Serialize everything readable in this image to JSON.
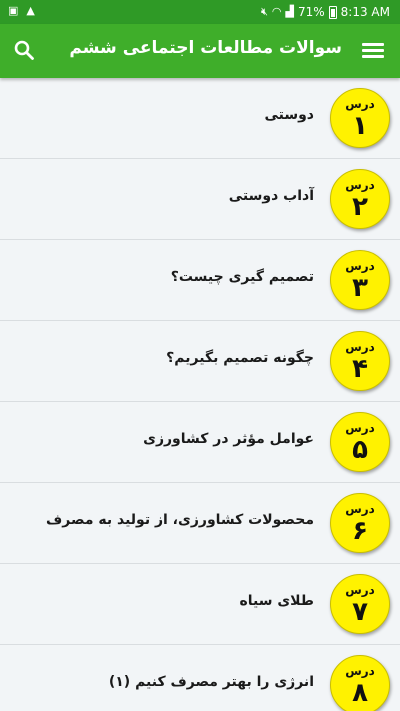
{
  "status_bar": {
    "battery": "71%",
    "time": "8:13 AM"
  },
  "app_bar": {
    "title": "سوالات مطالعات اجتماعی ششم",
    "menu_icon": "hamburger-menu-icon",
    "search_icon": "search-icon"
  },
  "colors": {
    "status_bar": "#2f9a26",
    "app_bar": "#3fae2a",
    "badge": "#fff200",
    "background": "#f2f5f7"
  },
  "lessons": [
    {
      "badge_label": "درس",
      "number": "۱",
      "title": "دوستی"
    },
    {
      "badge_label": "درس",
      "number": "۲",
      "title": "آداب دوستی"
    },
    {
      "badge_label": "درس",
      "number": "۳",
      "title": "تصمیم گیری چیست؟"
    },
    {
      "badge_label": "درس",
      "number": "۴",
      "title": "چگونه تصمیم بگیریم؟"
    },
    {
      "badge_label": "درس",
      "number": "۵",
      "title": "عوامل مؤثر در کشاورزی"
    },
    {
      "badge_label": "درس",
      "number": "۶",
      "title": "محصولات کشاورزی، از تولید به مصرف"
    },
    {
      "badge_label": "درس",
      "number": "۷",
      "title": "طلای سیاه"
    },
    {
      "badge_label": "درس",
      "number": "۸",
      "title": "انرژی را بهتر مصرف کنیم (۱)"
    }
  ]
}
